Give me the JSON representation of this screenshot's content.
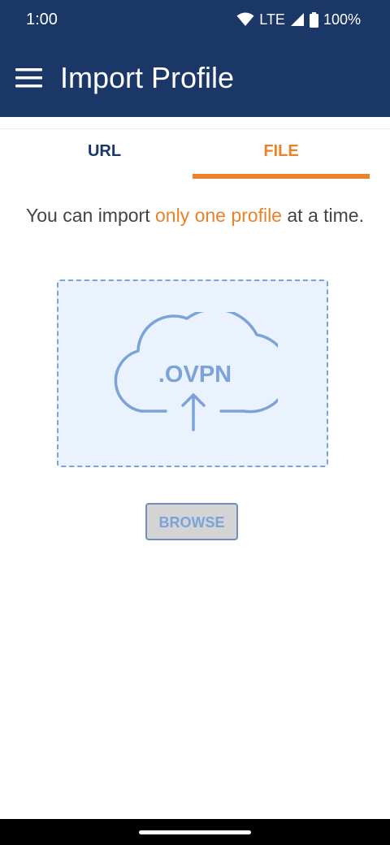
{
  "status_bar": {
    "time": "1:00",
    "network": "LTE",
    "battery": "100%",
    "icons": [
      "wifi-icon",
      "signal-icon",
      "battery-icon"
    ]
  },
  "app_bar": {
    "title": "Import Profile",
    "menu_icon": "hamburger-menu-icon"
  },
  "tabs": {
    "items": [
      {
        "label": "URL",
        "active": false
      },
      {
        "label": "FILE",
        "active": true
      }
    ]
  },
  "info": {
    "prefix": "You can import ",
    "highlight": "only one profile",
    "suffix": " at a time."
  },
  "drop_zone": {
    "label": ".OVPN",
    "icon": "cloud-upload-icon"
  },
  "browse_button": {
    "label": "BROWSE"
  },
  "colors": {
    "primary": "#1b3767",
    "accent": "#e8832a",
    "drop_zone_bg": "#eaf2fe",
    "drop_zone_border": "#7ba3d9",
    "text": "#444444"
  }
}
